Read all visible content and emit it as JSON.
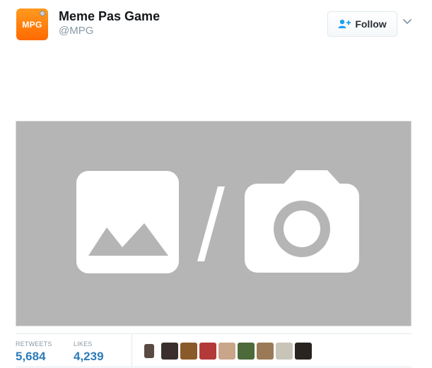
{
  "user": {
    "avatar_text": "MPG",
    "display_name": "Meme Pas Game",
    "handle": "@MPG"
  },
  "follow": {
    "label": "Follow",
    "icon": "add-user-icon"
  },
  "more_icon": "chevron-down-icon",
  "media": {
    "icons": [
      "image-icon",
      "camera-icon"
    ],
    "background": "#b5b5b5"
  },
  "stats": {
    "retweets_label": "RETWEETS",
    "retweets_value": "5,684",
    "likes_label": "LIKES",
    "likes_value": "4,239"
  },
  "likers": [
    {
      "color": "#5a4a44"
    },
    {
      "color": "#3a2f2a"
    },
    {
      "color": "#8a5a2a"
    },
    {
      "color": "#b43a3a"
    },
    {
      "color": "#c9a58a"
    },
    {
      "color": "#4c6a3a"
    },
    {
      "color": "#9a7a56"
    },
    {
      "color": "#c8c4b8"
    },
    {
      "color": "#2a2420"
    }
  ],
  "colors": {
    "accent": "#2b7bb9",
    "avatar_orange": "#ff7a00",
    "muted": "#8899a6"
  }
}
